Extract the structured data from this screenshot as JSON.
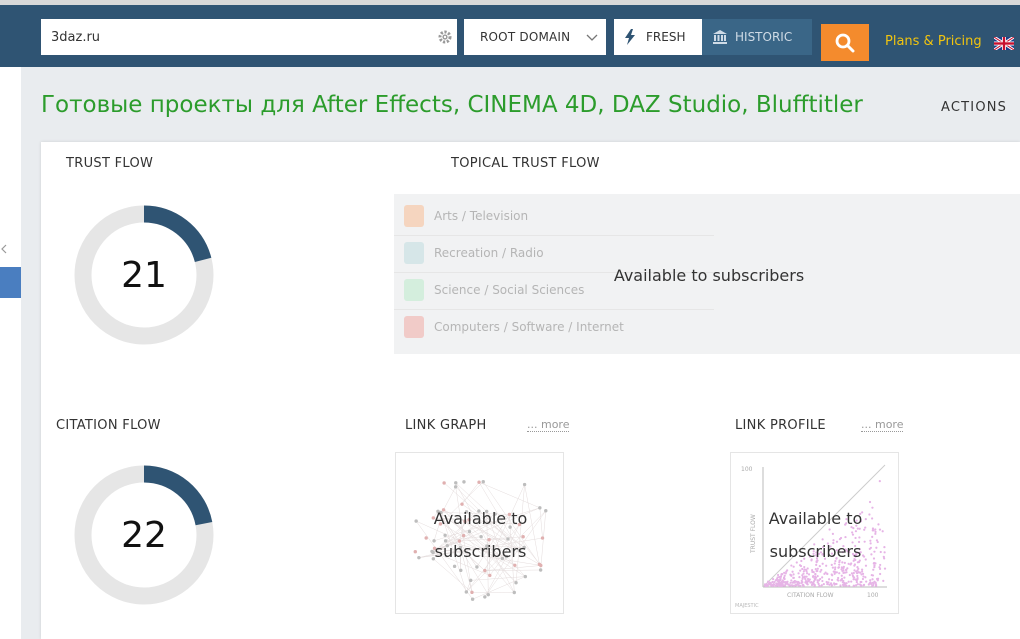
{
  "search": {
    "value": "3daz.ru"
  },
  "domain_select": {
    "selected": "ROOT DOMAIN"
  },
  "index": {
    "fresh_label": "FRESH",
    "historic_label": "HISTORIC"
  },
  "header": {
    "plans_label": "Plans & Pricing"
  },
  "page": {
    "title": "Готовые проекты для After Effects, CINEMA 4D, DAZ Studio, Blufftitler",
    "actions_label": "ACTIONS"
  },
  "trust_flow": {
    "label": "TRUST FLOW",
    "value": 21,
    "display": "21"
  },
  "citation_flow": {
    "label": "CITATION FLOW",
    "value": 22,
    "display": "22"
  },
  "topical": {
    "label": "TOPICAL TRUST FLOW",
    "topics": [
      {
        "name": "Arts / Television",
        "color": "#f5d5bf"
      },
      {
        "name": "Recreation / Radio",
        "color": "#d6e6e8"
      },
      {
        "name": "Science / Social Sciences",
        "color": "#d4eedd"
      },
      {
        "name": "Computers / Software / Internet",
        "color": "#f1cbc8"
      }
    ],
    "overlay": "Available to subscribers"
  },
  "link_graph": {
    "label": "LINK GRAPH",
    "more": "... more",
    "overlay_line1": "Available to",
    "overlay_line2": "subscribers"
  },
  "link_profile": {
    "label": "LINK PROFILE",
    "more": "... more",
    "overlay_line1": "Available to",
    "overlay_line2": "subscribers",
    "y_axis": "TRUST FLOW",
    "x_axis": "CITATION FLOW",
    "y_max": "100",
    "x_max": "100",
    "brand": "MAJESTIC"
  },
  "colors": {
    "donut_fill": "#2f5473",
    "donut_track": "#e6e6e6",
    "title_green": "#2c9c2c",
    "go_orange": "#f48b2d"
  },
  "icons": {
    "settings": "gear-icon",
    "search": "search-icon",
    "fresh": "lightning-icon",
    "historic": "bank-icon",
    "language": "uk-flag-icon"
  }
}
